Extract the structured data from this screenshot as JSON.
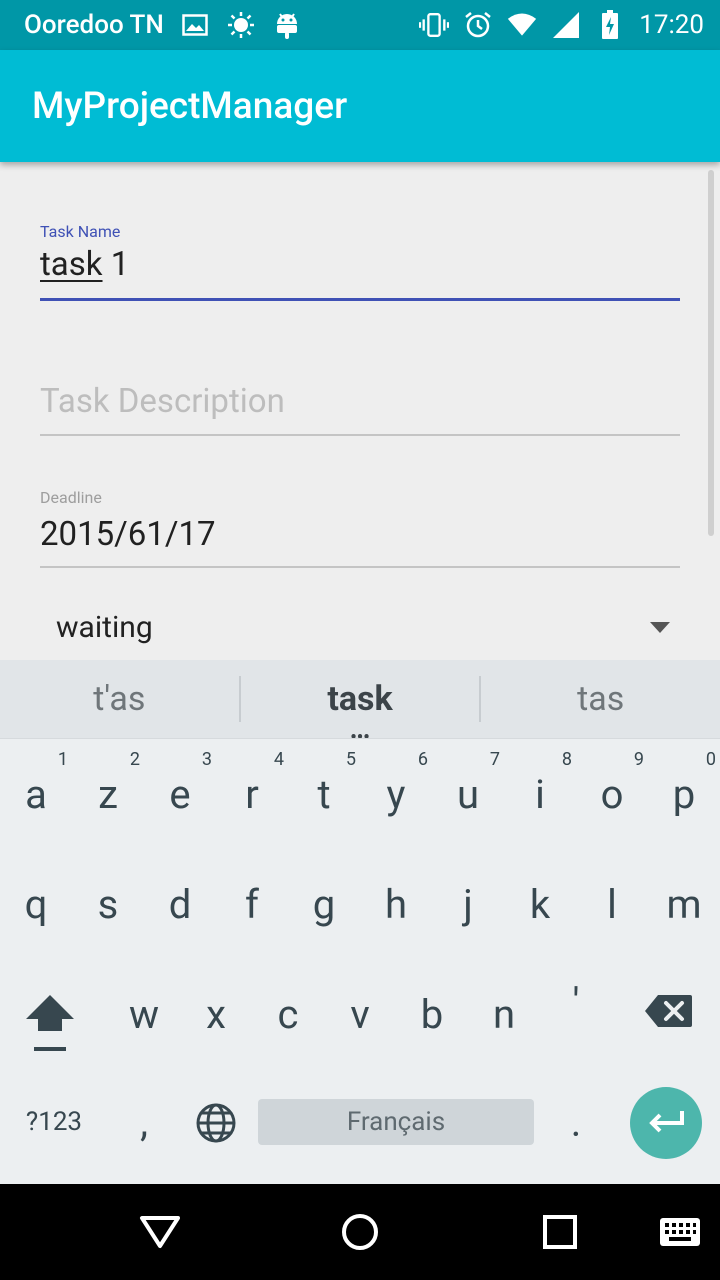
{
  "status_bar": {
    "carrier": "Ooredoo TN",
    "time": "17:20",
    "icons": [
      "image-icon",
      "brightness-icon",
      "android-icon",
      "vibrate-icon",
      "alarm-icon",
      "wifi-icon",
      "signal-icon",
      "battery-charging-icon"
    ]
  },
  "app_bar": {
    "title": "MyProjectManager"
  },
  "form": {
    "task_name": {
      "label": "Task Name",
      "value_word": "task",
      "value_rest": " 1"
    },
    "task_description": {
      "placeholder": "Task Description"
    },
    "deadline": {
      "label": "Deadline",
      "value": "2015/61/17"
    },
    "status": {
      "selected": "waiting"
    }
  },
  "suggestions": [
    "t'as",
    "task",
    "tas"
  ],
  "keyboard": {
    "row1": [
      {
        "key": "a",
        "num": "1"
      },
      {
        "key": "z",
        "num": "2"
      },
      {
        "key": "e",
        "num": "3"
      },
      {
        "key": "r",
        "num": "4"
      },
      {
        "key": "t",
        "num": "5"
      },
      {
        "key": "y",
        "num": "6"
      },
      {
        "key": "u",
        "num": "7"
      },
      {
        "key": "i",
        "num": "8"
      },
      {
        "key": "o",
        "num": "9"
      },
      {
        "key": "p",
        "num": "0"
      }
    ],
    "row2": [
      "q",
      "s",
      "d",
      "f",
      "g",
      "h",
      "j",
      "k",
      "l",
      "m"
    ],
    "row3": [
      "w",
      "x",
      "c",
      "v",
      "b",
      "n",
      "'"
    ],
    "symbols_label": "?123",
    "comma": ",",
    "space_label": "Français",
    "period": "."
  },
  "colors": {
    "status_bar": "#0097a7",
    "app_bar": "#00bcd4",
    "accent": "#3f51b5",
    "enter_key": "#4db6ac"
  }
}
